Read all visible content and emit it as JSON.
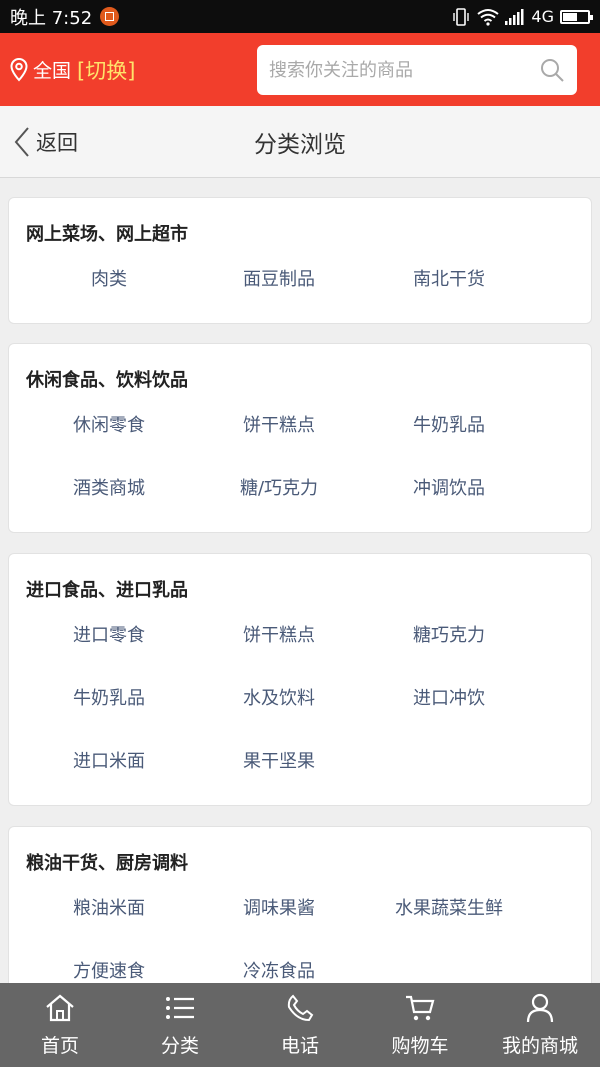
{
  "status_bar": {
    "time": "晚上 7:52",
    "network": "4G"
  },
  "header": {
    "location": "全国",
    "switch_label": "[切换]",
    "search_placeholder": "搜索你关注的商品"
  },
  "titlebar": {
    "back_label": "返回",
    "title": "分类浏览"
  },
  "categories": [
    {
      "title": "网上菜场、网上超市",
      "items": [
        "肉类",
        "面豆制品",
        "南北干货"
      ]
    },
    {
      "title": "休闲食品、饮料饮品",
      "items": [
        "休闲零食",
        "饼干糕点",
        "牛奶乳品",
        "酒类商城",
        "糖/巧克力",
        "冲调饮品"
      ]
    },
    {
      "title": "进口食品、进口乳品",
      "items": [
        "进口零食",
        "饼干糕点",
        "糖巧克力",
        "牛奶乳品",
        "水及饮料",
        "进口冲饮",
        "进口米面",
        "果干坚果"
      ]
    },
    {
      "title": "粮油干货、厨房调料",
      "items": [
        "粮油米面",
        "调味果酱",
        "水果蔬菜生鲜",
        "方便速食",
        "冷冻食品"
      ]
    }
  ],
  "bottom_nav": [
    {
      "label": "首页",
      "icon": "home-icon"
    },
    {
      "label": "分类",
      "icon": "list-icon"
    },
    {
      "label": "电话",
      "icon": "phone-icon"
    },
    {
      "label": "购物车",
      "icon": "cart-icon"
    },
    {
      "label": "我的商城",
      "icon": "user-icon"
    }
  ],
  "colors": {
    "header_red": "#f23e2c",
    "switch_yellow": "#ffe36b",
    "item_text": "#4a5a78",
    "nav_bg": "#666666"
  }
}
